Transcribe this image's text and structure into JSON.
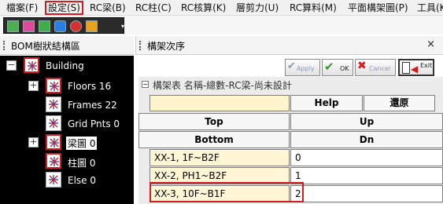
{
  "menubar": {
    "items": [
      "檔案(F)",
      "設定(S)",
      "RC梁(B)",
      "RC柱(C)",
      "RC核算(K)",
      "層剪力(U)",
      "RC算料(M)",
      "平面構架圖(P)",
      "工具(K"
    ]
  },
  "toolbar": {
    "dropdown_glyph": "▾"
  },
  "left_panel": {
    "title": "BOM樹狀結構區",
    "nodes": [
      {
        "label": "Building",
        "expander": "−"
      },
      {
        "label": "Floors 16",
        "expander": "+"
      },
      {
        "label": "Frames 22",
        "expander": ""
      },
      {
        "label": "Grid Pnts 0",
        "expander": ""
      },
      {
        "label": "梁圖 0",
        "expander": "+"
      },
      {
        "label": "柱圖 0",
        "expander": ""
      },
      {
        "label": "Else 0",
        "expander": ""
      }
    ]
  },
  "right_panel": {
    "title": "構架次序",
    "close": "×",
    "buttons": {
      "apply": "Apply",
      "ok": "OK",
      "cancel": "Cancel",
      "exit": "Exit"
    },
    "group_minus": "−",
    "group_title": "構架表 名稱-總數-RC梁-尚未設計",
    "headers": {
      "help": "Help",
      "restore": "還原",
      "top": "Top",
      "up": "Up",
      "bottom": "Bottom",
      "dn": "Dn"
    },
    "rows": [
      {
        "name": "XX-1, 1F~B2F",
        "value": "0"
      },
      {
        "name": "XX-2, PH1~B2F",
        "value": "1"
      },
      {
        "name": "XX-3, 10F~B1F",
        "value": "2"
      }
    ]
  },
  "colors": {
    "highlight_red": "#d71920",
    "tree_bg": "#000000",
    "row_bg": "#fff6d6"
  }
}
